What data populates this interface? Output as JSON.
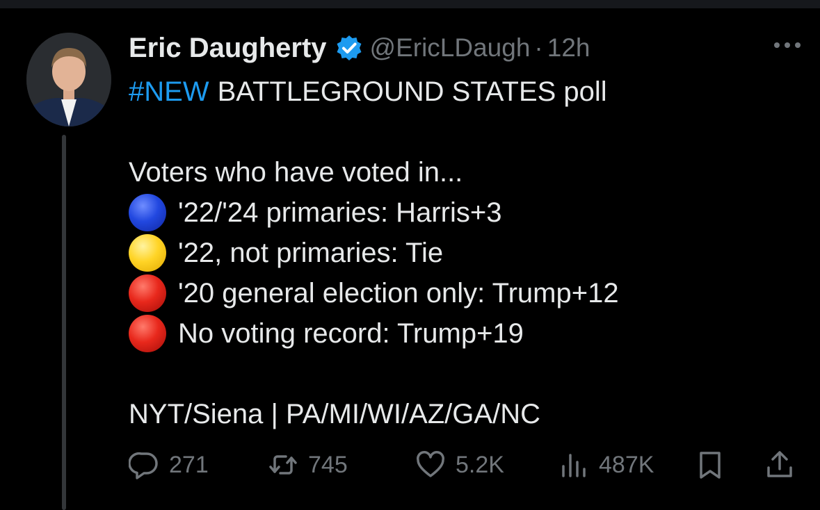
{
  "colors": {
    "accent": "#1d9bf0",
    "muted": "#71767b",
    "text": "#e7e9ea",
    "background": "#000000"
  },
  "author": {
    "name": "Eric Daugherty",
    "handle": "@EricLDaugh",
    "separator": "·",
    "time": "12h",
    "verified_icon": "verified-badge-icon",
    "avatar_icon": "avatar"
  },
  "tweet": {
    "hashtag": "#NEW",
    "headline": "BATTLEGROUND STATES poll",
    "intro": "Voters who have voted in...",
    "items": [
      {
        "emoji": "blue-circle",
        "text": "'22/'24 primaries: Harris+3"
      },
      {
        "emoji": "yellow-circle",
        "text": "'22, not primaries: Tie"
      },
      {
        "emoji": "red-circle",
        "text": "'20 general election only: Trump+12"
      },
      {
        "emoji": "red-circle",
        "text": "No voting record: Trump+19"
      }
    ],
    "source": "NYT/Siena | PA/MI/WI/AZ/GA/NC"
  },
  "actions": {
    "replies": "271",
    "reposts": "745",
    "likes": "5.2K",
    "views": "487K",
    "icons": [
      "reply-icon",
      "repost-icon",
      "like-icon",
      "views-icon",
      "bookmark-icon",
      "share-icon"
    ]
  }
}
